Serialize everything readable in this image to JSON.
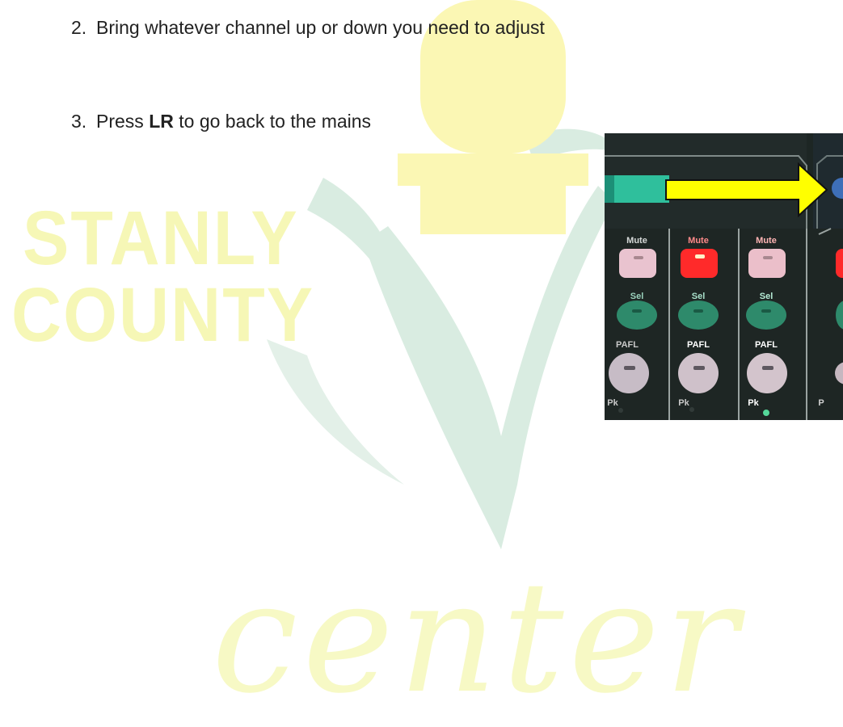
{
  "steps": [
    {
      "number": "2.",
      "text": "Bring whatever channel up or down you need to adjust"
    },
    {
      "number": "3.",
      "pre": "Press ",
      "bold": "LR",
      "post": " to go back to the mains"
    }
  ],
  "watermark": {
    "line1": "STANLY",
    "line2": "COUNTY",
    "word": "center"
  },
  "photo": {
    "channels": [
      {
        "mute": "Mute",
        "sel": "Sel",
        "pafl": "PAFL",
        "pk": "Pk"
      },
      {
        "mute": "Mute",
        "sel": "Sel",
        "pafl": "PAFL",
        "pk": "Pk"
      },
      {
        "mute": "Mute",
        "sel": "Sel",
        "pafl": "PAFL",
        "pk": "Pk"
      }
    ],
    "edge_pk": "P",
    "arrow_color": "#ffff00",
    "mute_lit_color": "#ff2a2a"
  }
}
